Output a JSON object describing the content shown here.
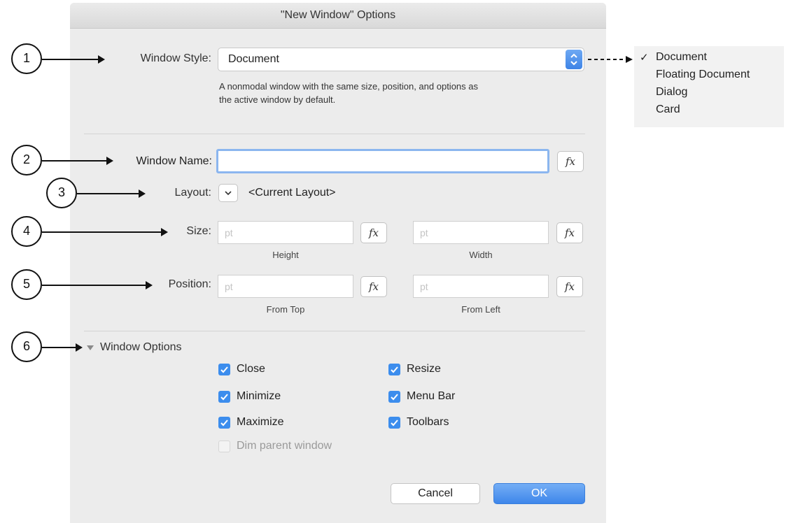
{
  "window": {
    "title": "\"New Window\" Options"
  },
  "callouts": [
    "1",
    "2",
    "3",
    "4",
    "5",
    "6"
  ],
  "window_style": {
    "label": "Window Style:",
    "value": "Document",
    "description_line1": "A nonmodal window with the same size, position, and options as",
    "description_line2": "the active window by default.",
    "menu_options": [
      "Document",
      "Floating Document",
      "Dialog",
      "Card"
    ],
    "selected_mark": "✓"
  },
  "window_name": {
    "label": "Window Name:",
    "value": ""
  },
  "layout": {
    "label": "Layout:",
    "value": "<Current Layout>"
  },
  "size": {
    "label": "Size:",
    "height": {
      "placeholder": "pt",
      "caption": "Height"
    },
    "width": {
      "placeholder": "pt",
      "caption": "Width"
    }
  },
  "position": {
    "label": "Position:",
    "from_top": {
      "placeholder": "pt",
      "caption": "From Top"
    },
    "from_left": {
      "placeholder": "pt",
      "caption": "From Left"
    }
  },
  "fx_label": "fx",
  "window_options": {
    "label": "Window Options",
    "checkboxes": [
      {
        "label": "Close",
        "checked": true
      },
      {
        "label": "Minimize",
        "checked": true
      },
      {
        "label": "Maximize",
        "checked": true
      },
      {
        "label": "Dim parent window",
        "checked": false,
        "disabled": true
      },
      {
        "label": "Resize",
        "checked": true
      },
      {
        "label": "Menu Bar",
        "checked": true
      },
      {
        "label": "Toolbars",
        "checked": true
      }
    ]
  },
  "buttons": {
    "cancel": "Cancel",
    "ok": "OK"
  },
  "colors": {
    "accent": "#3c8ded",
    "dialog_bg": "#ececec",
    "focus_ring": "#8bb6ef"
  }
}
